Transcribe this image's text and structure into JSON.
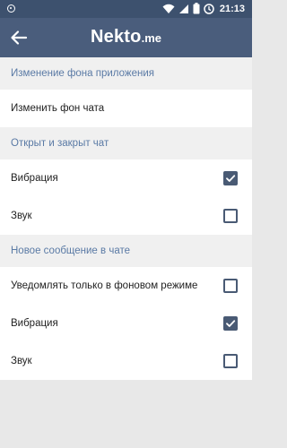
{
  "status_bar": {
    "time": "21:13"
  },
  "app_bar": {
    "logo_main": "Nekto",
    "logo_sub": ".me"
  },
  "settings": {
    "bg_section": {
      "title": "Изменение фона приложения",
      "change_chat_bg": "Изменить фон чата"
    },
    "chat_section": {
      "title": "Открыт и закрыт чат",
      "vibration": {
        "label": "Вибрация",
        "checked": true
      },
      "sound": {
        "label": "Звук",
        "checked": false
      }
    },
    "message_section": {
      "title": "Новое сообщение в чате",
      "background_only": {
        "label": "Уведомлять только в фоновом режиме",
        "checked": false
      },
      "vibration": {
        "label": "Вибрация",
        "checked": true
      },
      "sound": {
        "label": "Звук",
        "checked": false
      }
    }
  }
}
